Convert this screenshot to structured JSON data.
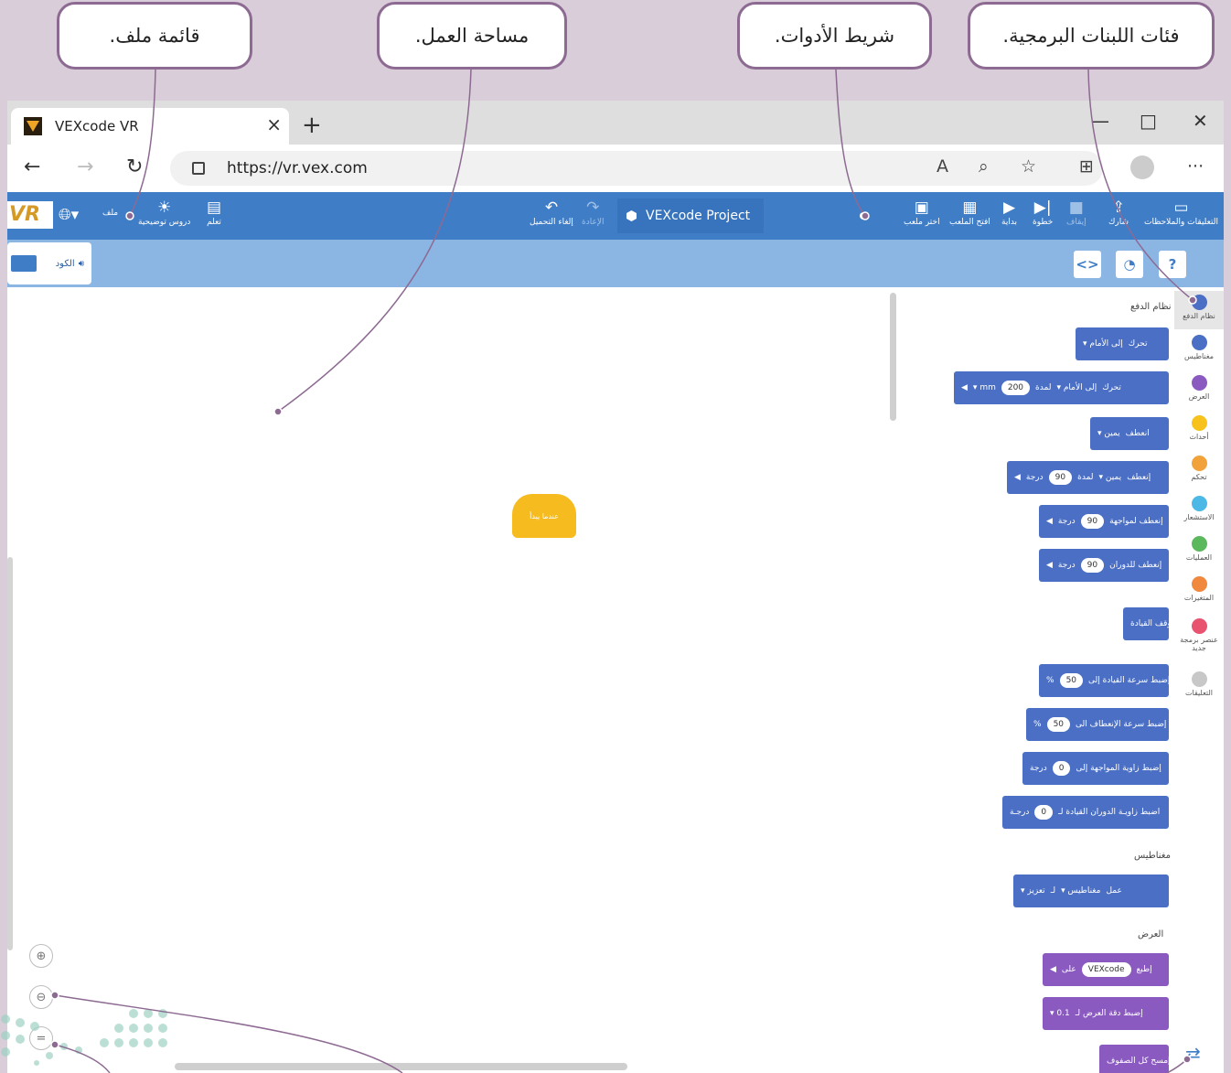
{
  "callouts": {
    "file_menu": "قائمة ملف.",
    "workspace": "مساحة العمل.",
    "toolbar": "شريط الأدوات.",
    "block_categories": "فئات اللبنات البرمجية."
  },
  "browser": {
    "tab_title": "VEXcode VR",
    "url": "https://vr.vex.com"
  },
  "toolbar": {
    "logo": "VR",
    "file": "ملف",
    "tutorials": "دروس توضيحية",
    "learn": "تعلم",
    "undo": "إلغاء التحميل",
    "redo": "الإعادة",
    "project_name": "VEXcode Project",
    "select_playground": "اختر ملعب",
    "open_playground": "افتح الملعب",
    "start": "بداية",
    "step": "خطوة",
    "stop": "إيقاف",
    "share": "شارك",
    "feedback": "التعليقات والملاحظات"
  },
  "subbar": {
    "code_tab": "الكود"
  },
  "workspace": {
    "when_started": "عندما يبدأ"
  },
  "palette": {
    "drivetrain_header": "نظام الدفع",
    "magnet_header": "مغناطيس",
    "looks_header": "العرض",
    "blocks": [
      {
        "label": "تحرك",
        "dir": "إلى الأمام"
      },
      {
        "label": "تحرك",
        "dir": "إلى الأمام",
        "for": "لمدة",
        "value": "200",
        "unit": "mm"
      },
      {
        "label": "انعطف",
        "dir": "يمين"
      },
      {
        "label": "إنعطف",
        "dir": "يمين",
        "for": "لمدة",
        "value": "90",
        "unit": "درجة"
      },
      {
        "label": "إنعطف لمواجهة",
        "value": "90",
        "unit": "درجة"
      },
      {
        "label": "إنعطف للدوران",
        "value": "90",
        "unit": "درجة"
      },
      {
        "label": "أوقف القيادة"
      },
      {
        "label": "إضبط سرعة القيادة إلى",
        "value": "50",
        "unit": "%"
      },
      {
        "label": "إضبط سرعة الإنعطاف الى",
        "value": "50",
        "unit": "%"
      },
      {
        "label": "إضبط زاوية المواجهة إلى",
        "value": "0",
        "unit": "درجة"
      },
      {
        "label": "اضبط زاويـة الدوران القيادة لـ",
        "value": "0",
        "unit": "درجـة"
      },
      {
        "label": "عمل",
        "dir": "مغناطيس",
        "to": "لـ",
        "action": "تعزيز"
      },
      {
        "label": "إطبع",
        "value": "VEXcode",
        "unit": "على"
      },
      {
        "label": "إضبط دقة العرض لـ",
        "value": "0.1"
      },
      {
        "label": "إمسح كل الصفوف"
      }
    ]
  },
  "categories": [
    {
      "label": "نظام الدفع",
      "color": "#4a6fc4"
    },
    {
      "label": "مغناطيس",
      "color": "#4a6fc4"
    },
    {
      "label": "العرض",
      "color": "#8a5ac1"
    },
    {
      "label": "أحداث",
      "color": "#f6c21b"
    },
    {
      "label": "تحكم",
      "color": "#f2a23a"
    },
    {
      "label": "الاستشعار",
      "color": "#4cb8e6"
    },
    {
      "label": "العمليات",
      "color": "#5cb85c"
    },
    {
      "label": "المتغيرات",
      "color": "#f0883e"
    },
    {
      "label": "عنصر برمجة جديد",
      "color": "#e8536f"
    },
    {
      "label": "التعليقات",
      "color": "#c8c8c8"
    }
  ]
}
